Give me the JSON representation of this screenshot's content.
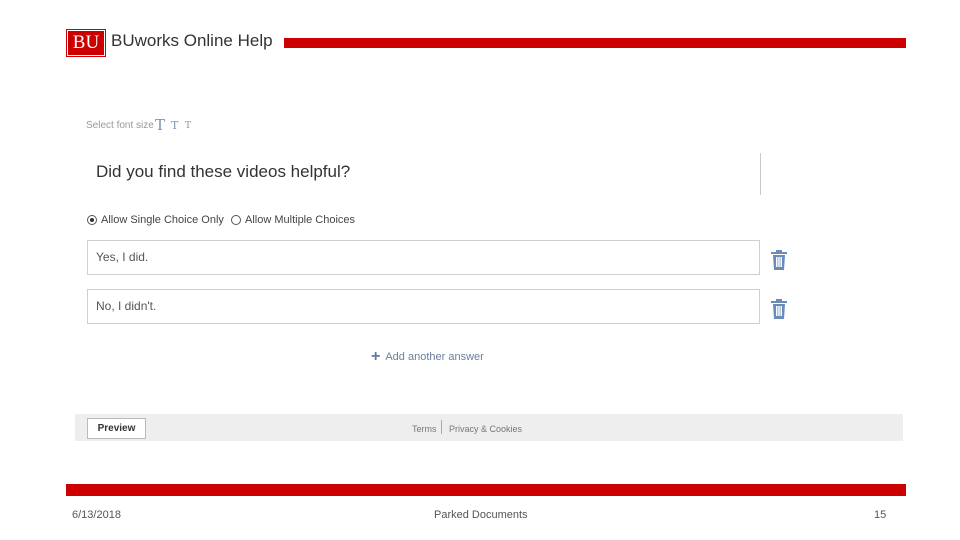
{
  "header": {
    "logo_text": "BU",
    "title": "BUworks Online Help",
    "brand_color": "#cc0000"
  },
  "font_size": {
    "label": "Select font size",
    "options": [
      "T",
      "T",
      "T"
    ]
  },
  "question": {
    "title": "Did you find these videos helpful?"
  },
  "choice_mode": {
    "single_label": "Allow Single Choice Only",
    "multiple_label": "Allow Multiple Choices",
    "selected": "single"
  },
  "answers": [
    {
      "text": "Yes, I did."
    },
    {
      "text": "No, I didn't."
    }
  ],
  "add_answer_label": "Add another answer",
  "footer": {
    "preview_label": "Preview",
    "terms_label": "Terms",
    "privacy_label": "Privacy & Cookies"
  },
  "slide": {
    "date": "6/13/2018",
    "caption": "Parked Documents",
    "number": "15"
  },
  "icons": {
    "delete": "trash-icon",
    "add": "plus-icon",
    "accent": "#6a8cb8"
  }
}
